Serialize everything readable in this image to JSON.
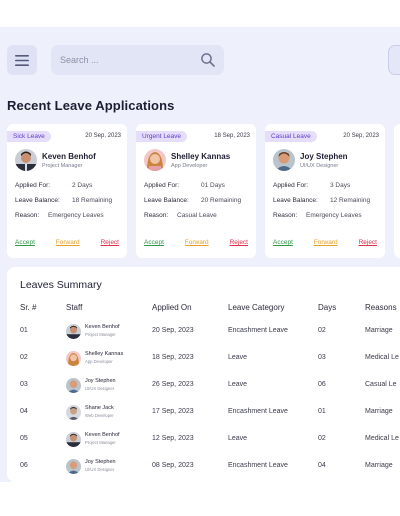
{
  "header": {
    "search_placeholder": "Search ..."
  },
  "page_title": "Recent Leave Applications",
  "leave_cards": [
    {
      "tag": "Sick Leave",
      "date": "20 Sep, 2023",
      "name": "Keven Benhof",
      "role": "Project Manager",
      "applied_for_label": "Applied For:",
      "applied_for": "2 Days",
      "balance_label": "Leave Balance:",
      "balance": "18 Remaining",
      "reason_label": "Reason:",
      "reason": "Emergency Leaves",
      "accept": "Accept",
      "forward": "Forward",
      "reject": "Reject"
    },
    {
      "tag": "Urgent Leave",
      "date": "18 Sep, 2023",
      "name": "Shelley Kannas",
      "role": "App Developer",
      "applied_for_label": "Applied For:",
      "applied_for": "01 Days",
      "balance_label": "Leave Balance:",
      "balance": "20 Remaining",
      "reason_label": "Reason:",
      "reason": "Casual Leave",
      "accept": "Accept",
      "forward": "Forward",
      "reject": "Reject"
    },
    {
      "tag": "Casual Leave",
      "date": "20 Sep, 2023",
      "name": "Joy Stephen",
      "role": "UI/UX Designer",
      "applied_for_label": "Applied For:",
      "applied_for": "3 Days",
      "balance_label": "Leave Balance:",
      "balance": "12 Remaining",
      "reason_label": "Reason:",
      "reason": "Emergency Leaves",
      "accept": "Accept",
      "forward": "Forward",
      "reject": "Reject"
    }
  ],
  "summary": {
    "title": "Leaves Summary",
    "columns": [
      "Sr. #",
      "Staff",
      "Applied On",
      "Leave Category",
      "Days",
      "Reasons"
    ],
    "rows": [
      {
        "sr": "01",
        "name": "Keven Benhof",
        "role": "Project Manager",
        "applied_on": "20 Sep, 2023",
        "category": "Encashment Leave",
        "days": "02",
        "reason": "Marriage"
      },
      {
        "sr": "02",
        "name": "Shelley Kannas",
        "role": "App Developer",
        "applied_on": "18 Sep, 2023",
        "category": "Leave",
        "days": "03",
        "reason": "Medical Le"
      },
      {
        "sr": "03",
        "name": "Joy Stephen",
        "role": "UI/UX Designer",
        "applied_on": "26 Sep, 2023",
        "category": "Leave",
        "days": "06",
        "reason": "Casual Le"
      },
      {
        "sr": "04",
        "name": "Shane Jack",
        "role": "Web Developer",
        "applied_on": "17 Sep, 2023",
        "category": "Encashment Leave",
        "days": "01",
        "reason": "Marriage"
      },
      {
        "sr": "05",
        "name": "Keven Benhof",
        "role": "Project Manager",
        "applied_on": "12 Sep, 2023",
        "category": "Leave",
        "days": "02",
        "reason": "Medical Le"
      },
      {
        "sr": "06",
        "name": "Joy Stephen",
        "role": "UI/UX Designer",
        "applied_on": "08 Sep, 2023",
        "category": "Encashment Leave",
        "days": "04",
        "reason": "Marriage"
      }
    ]
  },
  "colors": {
    "background": "#eef0fb",
    "tag_bg": "#e6ddfa",
    "tag_text": "#5b3fc7",
    "accept": "#2f9a4a",
    "forward": "#e7a12a",
    "reject": "#e0304a"
  }
}
